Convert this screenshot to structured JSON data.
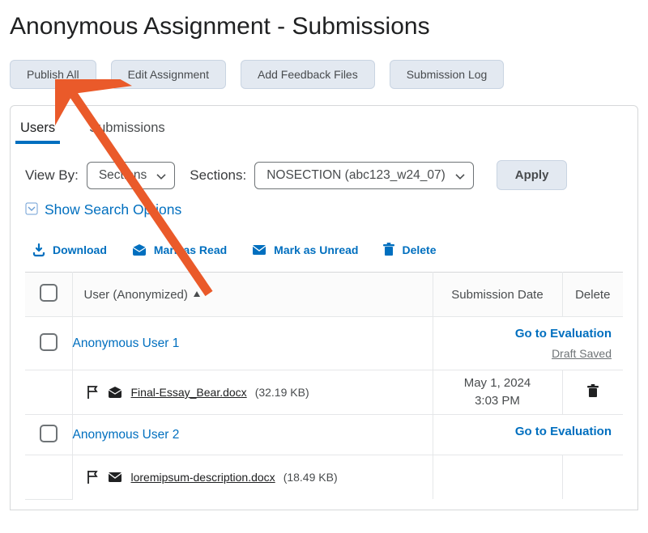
{
  "page_title": "Anonymous Assignment - Submissions",
  "buttons": {
    "publish_all": "Publish All",
    "edit_assignment": "Edit Assignment",
    "add_feedback": "Add Feedback Files",
    "submission_log": "Submission Log"
  },
  "tabs": {
    "users": "Users",
    "submissions": "Submissions"
  },
  "filters": {
    "view_by_label": "View By:",
    "view_by_value": "Sections",
    "sections_label": "Sections:",
    "sections_value": "NOSECTION (abc123_w24_07)",
    "apply": "Apply"
  },
  "search_options": "Show Search Options",
  "actions": {
    "download": "Download",
    "mark_read": "Mark as Read",
    "mark_unread": "Mark as Unread",
    "delete": "Delete"
  },
  "table": {
    "headers": {
      "user": "User (Anonymized)",
      "date": "Submission Date",
      "delete": "Delete"
    },
    "go_to_eval": "Go to Evaluation",
    "draft_saved": "Draft Saved",
    "rows": [
      {
        "user": "Anonymous User 1",
        "has_draft": true,
        "file": "Final-Essay_Bear.docx",
        "size": "(32.19 KB)",
        "date": "May 1, 2024",
        "time": "3:03 PM"
      },
      {
        "user": "Anonymous User 2",
        "has_draft": false,
        "file": "loremipsum-description.docx",
        "size": "(18.49 KB)",
        "date": "",
        "time": ""
      }
    ]
  },
  "colors": {
    "link": "#006fbf",
    "btn_bg": "#e3e9f1",
    "arrow": "#ea5a2a"
  }
}
